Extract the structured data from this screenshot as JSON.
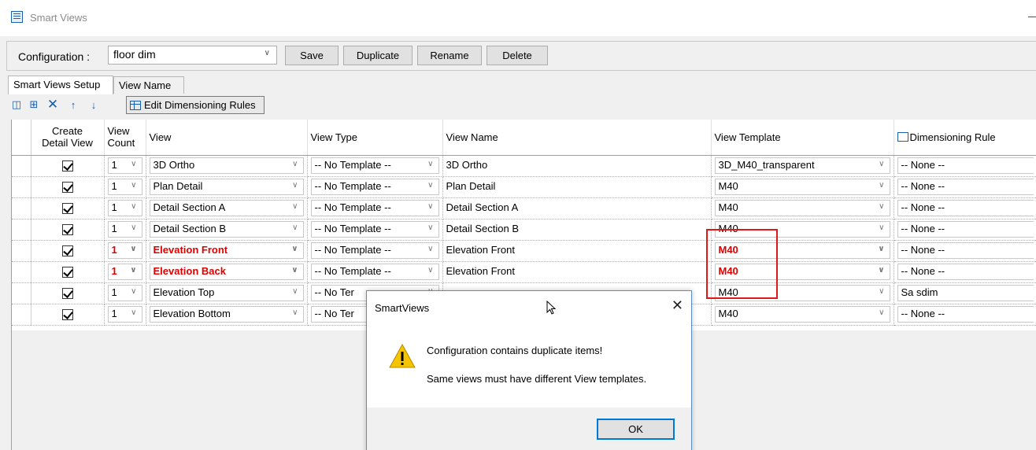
{
  "window": {
    "title": "Smart Views",
    "minimize_glyph": "—"
  },
  "config": {
    "label": "Configuration  :",
    "value": "floor dim",
    "buttons": {
      "save": "Save",
      "duplicate": "Duplicate",
      "rename": "Rename",
      "delete": "Delete"
    }
  },
  "tabs": [
    "Smart Views Setup",
    "View Name"
  ],
  "toolbar": {
    "icons": [
      "add-row-icon",
      "add-copy-icon",
      "delete-icon",
      "move-up-icon",
      "move-down-icon"
    ],
    "edit_rules": "Edit Dimensioning Rules"
  },
  "grid": {
    "headers": {
      "create": "Create\nDetail View",
      "count": "View\nCount",
      "view": "View",
      "view_type": "View Type",
      "view_name": "View Name",
      "view_template": "View Template",
      "dim_rule": "Dimensioning Rule"
    },
    "rows": [
      {
        "count": "1",
        "view": "3D Ortho",
        "view_type": "-- No Template --",
        "view_name": "3D Ortho",
        "view_template": "3D_M40_transparent",
        "dim_rule": "-- None --",
        "dup": false
      },
      {
        "count": "1",
        "view": "Plan Detail",
        "view_type": "-- No Template --",
        "view_name": "Plan Detail",
        "view_template": "M40",
        "dim_rule": "-- None --",
        "dup": false
      },
      {
        "count": "1",
        "view": "Detail Section A",
        "view_type": "-- No Template --",
        "view_name": "Detail Section A",
        "view_template": "M40",
        "dim_rule": "-- None --",
        "dup": false
      },
      {
        "count": "1",
        "view": "Detail Section B",
        "view_type": "-- No Template --",
        "view_name": "Detail Section B",
        "view_template": "M40",
        "dim_rule": "-- None --",
        "dup": false
      },
      {
        "count": "1",
        "view": "Elevation Front",
        "view_type": "-- No Template --",
        "view_name": "Elevation Front",
        "view_template": "M40",
        "dim_rule": "-- None --",
        "dup": true
      },
      {
        "count": "1",
        "view": "Elevation Back",
        "view_type": "-- No Template --",
        "view_name": "Elevation Front",
        "view_template": "M40",
        "dim_rule": "-- None --",
        "dup": true
      },
      {
        "count": "1",
        "view": "Elevation Top",
        "view_type": "-- No Ter",
        "view_name": "",
        "view_template": "M40",
        "dim_rule": "Sa sdim",
        "dup": false
      },
      {
        "count": "1",
        "view": "Elevation Bottom",
        "view_type": "-- No Ter",
        "view_name": "",
        "view_template": "M40",
        "dim_rule": "-- None --",
        "dup": false
      }
    ]
  },
  "dialog": {
    "title": "SmartViews",
    "message1": "Configuration contains duplicate items!",
    "message2": "Same views must have different View templates.",
    "ok": "OK"
  },
  "colors": {
    "error_red": "#e00000",
    "accent_blue": "#0078d7"
  }
}
